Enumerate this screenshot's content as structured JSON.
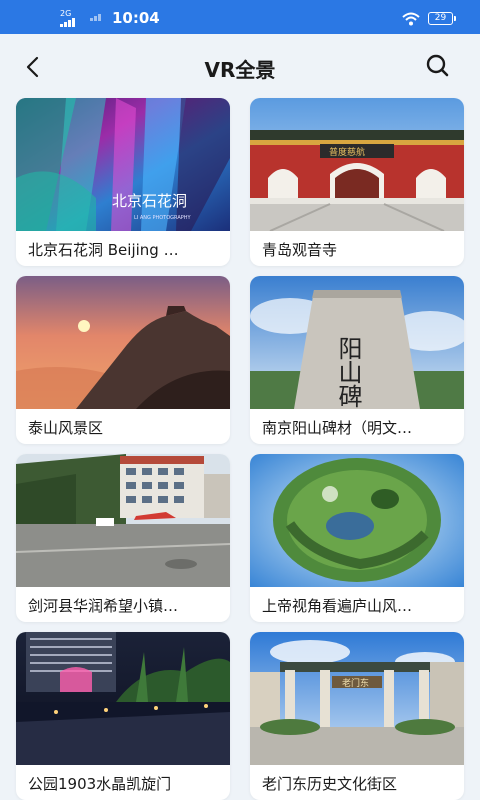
{
  "status_bar": {
    "network": "2G",
    "time": "10:04",
    "battery": "29"
  },
  "header": {
    "title": "VR全景"
  },
  "panoramas": [
    {
      "caption": "北京石花洞 Beijing …",
      "thumb_text": "北京石花洞",
      "thumb_subtext": "LI ANG PHOTOGRAPHY"
    },
    {
      "caption": "青岛观音寺",
      "thumb_text": "普度慈航"
    },
    {
      "caption": "泰山风景区"
    },
    {
      "caption": "南京阳山碑材（明文…",
      "thumb_text": "阳山碑"
    },
    {
      "caption": "剑河县华润希望小镇…"
    },
    {
      "caption": "上帝视角看遍庐山风…"
    },
    {
      "caption": "公园1903水晶凯旋门"
    },
    {
      "caption": "老门东历史文化街区",
      "thumb_text": "老门东"
    }
  ],
  "colors": {
    "status_bar_bg": "#2b78e4",
    "page_bg": "#eef3f8",
    "card_bg": "#ffffff",
    "text": "#1a1a1a"
  },
  "icons": {
    "back": "chevron-left-icon",
    "search": "search-icon"
  }
}
